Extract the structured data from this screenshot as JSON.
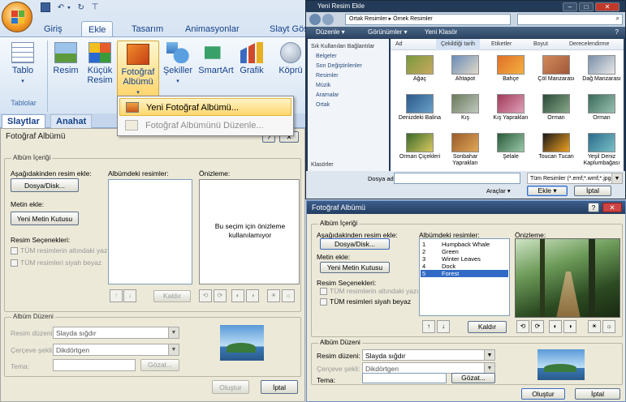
{
  "ribbon": {
    "tabs": [
      "Giriş",
      "Ekle",
      "Tasarım",
      "Animasyonlar",
      "Slayt Gös"
    ],
    "active_tab": "Ekle",
    "buttons": {
      "tablo": "Tablo",
      "resim": "Resim",
      "kucuk_resim_1": "Küçük",
      "kucuk_resim_2": "Resim",
      "album_1": "Fotoğraf",
      "album_2": "Albümü",
      "sekiller": "Şekiller",
      "smartart": "SmartArt",
      "grafik": "Grafik",
      "kopru": "Köprü"
    },
    "group_tablolar": "Tablolar",
    "menu_new": "Yeni Fotoğraf Albümü...",
    "menu_edit": "Fotoğraf Albümünü Düzenle..."
  },
  "slide_tabs": {
    "slaytlar": "Slaytlar",
    "anahat": "Anahat"
  },
  "dialog1": {
    "title": "Fotoğraf Albümü",
    "help": "?",
    "close": "✕",
    "album_content": "Albüm İçeriği",
    "insert_from": "Aşağıdakinden resim ekle:",
    "file_disk": "Dosya/Disk...",
    "insert_text": "Metin ekle:",
    "new_textbox": "Yeni Metin Kutusu",
    "picture_options": "Resim Seçenekleri:",
    "opt_captions": "TÜM resimlerin altındaki yazılar",
    "opt_bw": "TÜM resimleri siyah beyaz",
    "pictures_in_album": "Albümdeki resimler:",
    "preview": "Önizleme:",
    "preview_text": "Bu seçim için önizleme kullanılamıyor",
    "remove": "Kaldır",
    "layout": "Albüm Düzeni",
    "picture_layout": "Resim düzeni:",
    "picture_layout_val": "Slayda sığdır",
    "frame_shape": "Çerçeve şekli:",
    "frame_shape_val": "Dikdörtgen",
    "theme": "Tema:",
    "browse": "Gözat...",
    "create": "Oluştur",
    "cancel": "İptal"
  },
  "browser": {
    "title": "Yeni Resim Ekle",
    "address": "Ortak Resimler ▸ Örnek Resimler",
    "organize": "Düzenle",
    "views": "Görünümler",
    "new_folder": "Yeni Klasör",
    "nav_header": "Sık Kullanılan Bağlantılar",
    "nav_items": [
      "Belgeler",
      "Son Değiştirilenler",
      "Resimler",
      "Müzik",
      "Aramalar",
      "Ortak"
    ],
    "folders": "Klasörler",
    "col_headers": [
      "Ad",
      "Çekildiği tarih",
      "Etiketler",
      "Boyut",
      "Derecelendirme"
    ],
    "thumbs": [
      {
        "label": "Ağaç",
        "c1": "#7a9a3c",
        "c2": "#c8a860"
      },
      {
        "label": "Ahtapot",
        "c1": "#6a8db8",
        "c2": "#e0d8c8"
      },
      {
        "label": "Bahçe",
        "c1": "#e07028",
        "c2": "#f4b040"
      },
      {
        "label": "Çöl Manzarası",
        "c1": "#d28a5a",
        "c2": "#a0583a"
      },
      {
        "label": "Dağ Manzarası",
        "c1": "#7a8fa8",
        "c2": "#e8e8e8"
      },
      {
        "label": "Denizdeki Balina",
        "c1": "#2a5a8a",
        "c2": "#6aa0c8"
      },
      {
        "label": "Kış",
        "c1": "#6a7a5a",
        "c2": "#c0c8c0"
      },
      {
        "label": "Kış Yaprakları",
        "c1": "#a03a5a",
        "c2": "#e0a0b8"
      },
      {
        "label": "Orman",
        "c1": "#2a4a3a",
        "c2": "#88a888"
      },
      {
        "label": "Orman",
        "c1": "#3a6a5a",
        "c2": "#9ac0b0"
      },
      {
        "label": "Orman Çiçekleri",
        "c1": "#3a6a2a",
        "c2": "#d8c860"
      },
      {
        "label": "Sonbahar Yaprakları",
        "c1": "#9a5a2a",
        "c2": "#e0a858"
      },
      {
        "label": "Şelale",
        "c1": "#2a5a3a",
        "c2": "#9ac8a8"
      },
      {
        "label": "Toucan Tucan",
        "c1": "#1a1a1a",
        "c2": "#f0a020"
      },
      {
        "label": "Yeşil Deniz Kaplumbağası",
        "c1": "#2a6a8a",
        "c2": "#7ac0c8"
      }
    ],
    "filename_label": "Dosya adı:",
    "filetype": "Tüm Resimler (*.emf;*.wmf;*.jpg;*.j",
    "tools": "Araçlar",
    "insert": "Ekle",
    "cancel": "İptal"
  },
  "dialog2": {
    "title": "Fotoğraf Albümü",
    "help": "?",
    "close": "✕",
    "album_content": "Albüm İçeriği",
    "insert_from": "Aşağıdakinden resim ekle:",
    "file_disk": "Dosya/Disk...",
    "insert_text": "Metin ekle:",
    "new_textbox": "Yeni Metin Kutusu",
    "picture_options": "Resim Seçenekleri:",
    "opt_captions": "TÜM resimlerin altındaki yazılar",
    "opt_bw": "TÜM resimleri siyah beyaz",
    "pictures_in_album": "Albümdeki resimler:",
    "preview": "Önizleme:",
    "list": [
      {
        "num": "1",
        "name": "Humpback Whale"
      },
      {
        "num": "2",
        "name": "Green"
      },
      {
        "num": "3",
        "name": "Winter Leaves"
      },
      {
        "num": "4",
        "name": "Dock"
      },
      {
        "num": "5",
        "name": "Forest"
      }
    ],
    "remove": "Kaldır",
    "layout": "Albüm Düzeni",
    "picture_layout": "Resim düzeni:",
    "picture_layout_val": "Slayda sığdır",
    "frame_shape": "Çerçeve şekli:",
    "frame_shape_val": "Dikdörtgen",
    "theme": "Tema:",
    "browse": "Gözat...",
    "create": "Oluştur",
    "cancel": "İptal"
  },
  "colors": {
    "accent": "#15428b",
    "selection": "#316ac5"
  }
}
